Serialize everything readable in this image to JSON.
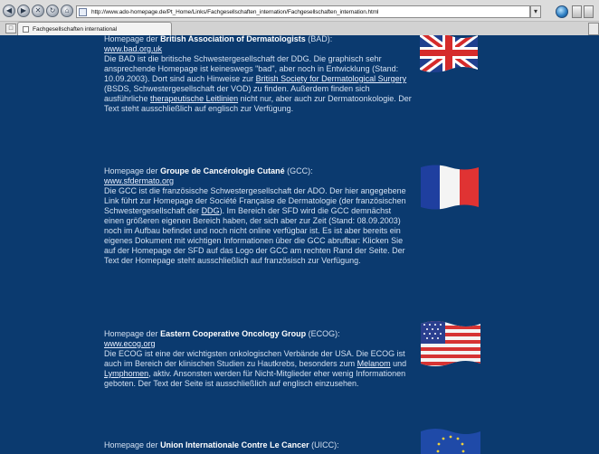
{
  "browser": {
    "url": "http://www.ado-homepage.de/Pt_Home/Links/Fachgesellschaften_internation/Fachgesellschaften_internation.html",
    "tab_title": "Fachgesellschaften international"
  },
  "entries": [
    {
      "head_prefix": "Homepage der",
      "org": "British Association of Dermatologists",
      "abbr": "(BAD):",
      "link": "www.bad.org.uk",
      "body": [
        {
          "t": "Die BAD ist die britische Schwestergesellschaft der DDG. Die graphisch sehr ansprechende Homepage ist keineswegs \"bad\", aber noch in Entwicklung (Stand: 10.09.2003). Dort sind auch Hinweise zur "
        },
        {
          "t": "British Society for Dermatological Surgery",
          "link": true
        },
        {
          "t": " (BSDS, Schwestergesellschaft der VOD) zu finden. Außerdem finden sich ausführliche "
        },
        {
          "t": "therapeutische Leitlinien",
          "link": true
        },
        {
          "t": " nicht nur, aber auch zur Dermatoonkologie. Der Text steht ausschließlich auf englisch zur Verfügung."
        }
      ],
      "flag": "uk-flag"
    },
    {
      "head_prefix": "Homepage der",
      "org": "Groupe de Cancérologie Cutané",
      "abbr": "(GCC):",
      "link": "www.sfdermato.org",
      "body": [
        {
          "t": "Die GCC ist die französische Schwestergesellschaft der ADO. Der hier angegebene Link führt zur Homepage der Société Française de Dermatologie (der französischen Schwestergesellschaft der "
        },
        {
          "t": "DDG",
          "link": true
        },
        {
          "t": "). Im Bereich der SFD wird die GCC demnächst einen größeren eigenen Bereich haben, der sich aber zur Zeit (Stand: 08.09.2003) noch im Aufbau befindet und noch nicht online verfügbar ist. Es ist aber bereits ein eigenes Dokument mit wichtigen Informationen über die GCC abrufbar: Klicken Sie auf der Homepage der SFD auf das Logo der GCC am rechten Rand der Seite. Der Text der Homepage steht ausschließlich auf französisch zur Verfügung."
        }
      ],
      "flag": "france-flag"
    },
    {
      "head_prefix": "Homepage der",
      "org": "Eastern Cooperative Oncology Group",
      "abbr": "(ECOG):",
      "link": "www.ecog.org",
      "body": [
        {
          "t": "Die ECOG ist eine der wichtigsten onkologischen Verbände der USA. Die ECOG ist auch im Bereich der klinischen Studien zu Hautkrebs, besonders zum "
        },
        {
          "t": "Melanom",
          "link": true
        },
        {
          "t": " und "
        },
        {
          "t": "Lymphomen",
          "link": true
        },
        {
          "t": ", aktiv. Ansonsten werden für Nicht-Mitglieder eher wenig Informationen geboten. Der Text der Seite ist ausschließlich auf englisch einzusehen."
        }
      ],
      "flag": "usa-flag"
    },
    {
      "head_prefix": "Homepage der",
      "org": "Union Internationale Contre Le Cancer",
      "abbr": "(UICC):",
      "flag": "eu-flag"
    }
  ],
  "colors": {
    "page_bg": "#0b3a6f",
    "text": "#d3e0f1",
    "org": "#ffffff",
    "link": "#e8efff"
  }
}
